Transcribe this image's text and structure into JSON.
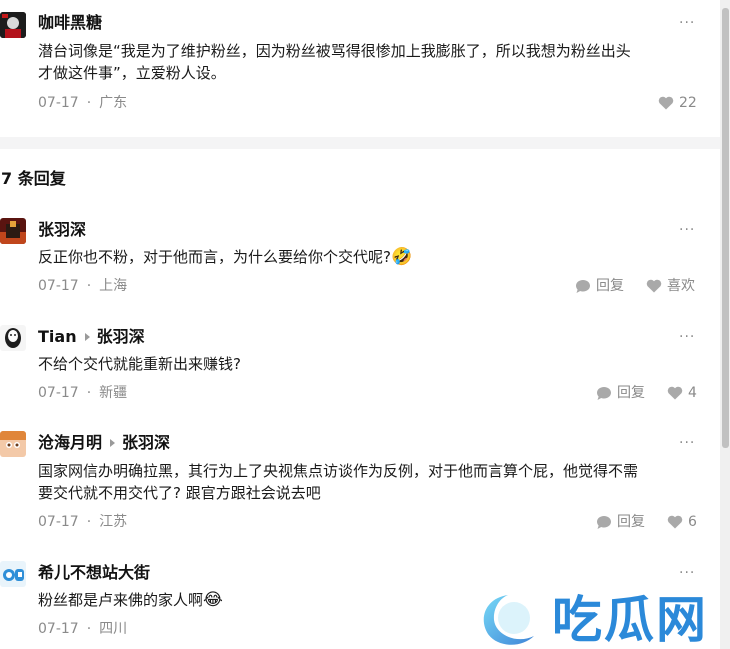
{
  "top_comment": {
    "user": "咖啡黑糖",
    "text_line1": "潜台词像是“我是为了维护粉丝，因为粉丝被骂得很惨加上我膨胀了，所以我想为粉丝出头",
    "text_line2": "才做这件事”，立爱粉人设。",
    "date": "07-17",
    "location": "广东",
    "likes": "22"
  },
  "replies_header": "7 条回复",
  "replies": [
    {
      "user": "张羽深",
      "reply_to": "",
      "text": "反正你也不粉，对于他而言，为什么要给你个交代呢?",
      "emoji": "🤣",
      "date": "07-17",
      "location": "上海",
      "reply_label": "回复",
      "like_label": "喜欢"
    },
    {
      "user": "Tian",
      "reply_to": "张羽深",
      "text": "不给个交代就能重新出来赚钱?",
      "date": "07-17",
      "location": "新疆",
      "reply_label": "回复",
      "likes": "4"
    },
    {
      "user": "沧海月明",
      "reply_to": "张羽深",
      "text_line1": "国家网信办明确拉黑，其行为上了央视焦点访谈作为反例，对于他而言算个屁，他觉得不需",
      "text_line2": "要交代就不用交代了? 跟官方跟社会说去吧",
      "date": "07-17",
      "location": "江苏",
      "reply_label": "回复",
      "likes": "6"
    },
    {
      "user": "希儿不想站大街",
      "reply_to": "",
      "text": "粉丝都是卢来佛的家人啊",
      "emoji": "😂",
      "date": "07-17",
      "location": "四川"
    }
  ],
  "more_label": "···",
  "watermark": "吃瓜网",
  "icons": {
    "like": "heart-icon",
    "reply": "chat-bubble-icon",
    "more": "ellipsis-icon"
  },
  "colors": {
    "text": "#1a1a1a",
    "meta": "#8a8a8a",
    "band": "#f4f4f5",
    "watermark": "#1a7fd6"
  }
}
